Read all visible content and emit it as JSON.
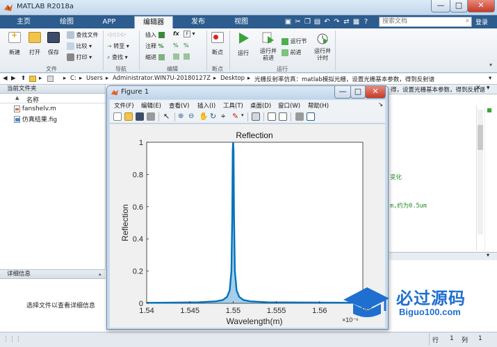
{
  "window": {
    "title": "MATLAB R2018a",
    "min_glyph": "—",
    "max_glyph": "□",
    "close_glyph": "✕"
  },
  "tabs": [
    "主页",
    "绘图",
    "APP",
    "编辑器",
    "发布",
    "视图"
  ],
  "active_tab": "编辑器",
  "search": {
    "placeholder": "搜索文档"
  },
  "login_label": "登录",
  "ribbon": {
    "file": {
      "new": "新建",
      "open": "打开",
      "save": "保存",
      "find_files": "查找文件",
      "compare": "比较",
      "print": "打印",
      "group": "文件"
    },
    "navigate": {
      "goto": "转至",
      "find": "查找",
      "group": "导航"
    },
    "edit": {
      "insert": "插入",
      "comment": "注释",
      "indent": "缩进",
      "fx": "fx",
      "group": "编辑"
    },
    "breakpoints": {
      "label": "断点",
      "group": "断点"
    },
    "run": {
      "run": "运行",
      "run_advance_1": "运行并",
      "run_advance_2": "前进",
      "run_section": "运行节",
      "advance": "前进",
      "run_time_1": "运行并",
      "run_time_2": "计时",
      "group": "运行"
    }
  },
  "address": {
    "drive": "C:",
    "parts": [
      "Users",
      "Administrator.WIN7U-20180127Z",
      "Desktop",
      "光栅反射率仿真：matlab模拟光栅，设置光栅基本参数，得到反射谱"
    ]
  },
  "folder_panel": {
    "title": "当前文件夹",
    "column": "名称",
    "sort": "▲",
    "files": [
      {
        "name": "fanshelv.m",
        "icon": "m-file-icon"
      },
      {
        "name": "仿真结果.fig",
        "icon": "fig-file-icon"
      }
    ]
  },
  "details_panel": {
    "title": "详细信息",
    "message": "选择文件以查看详细信息"
  },
  "editor_peek": {
    "path_tail": "得，设置光栅基本参数，得到反射谱",
    "line1": "变化",
    "line2": "m,约为0.5um"
  },
  "statusbar": {
    "row_label": "行",
    "row_value": "1",
    "col_label": "列",
    "col_value": "1"
  },
  "figure": {
    "title": "Figure 1",
    "menu": [
      "文件(F)",
      "编辑(E)",
      "查看(V)",
      "插入(I)",
      "工具(T)",
      "桌面(D)",
      "窗口(W)",
      "帮助(H)"
    ]
  },
  "chart_data": {
    "type": "line",
    "title": "Reflection",
    "xlabel": "Wavelength(m)",
    "ylabel": "Reflection",
    "x_exponent": "×10⁻⁶",
    "xlim": [
      1.54,
      1.565
    ],
    "ylim": [
      0,
      1
    ],
    "xticks": [
      "1.54",
      "1.545",
      "1.55",
      "1.555",
      "1.56",
      "1.565"
    ],
    "yticks": [
      "0",
      "0.2",
      "0.4",
      "0.6",
      "0.8",
      "1"
    ],
    "series": [
      {
        "color": "#0072bd",
        "x": [
          1.54,
          1.546,
          1.548,
          1.5488,
          1.5493,
          1.5496,
          1.5498,
          1.5499,
          1.54995,
          1.55,
          1.55005,
          1.5501,
          1.5502,
          1.5504,
          1.5507,
          1.5512,
          1.552,
          1.554,
          1.565
        ],
        "y": [
          0.003,
          0.006,
          0.012,
          0.02,
          0.04,
          0.08,
          0.2,
          0.55,
          0.95,
          1.0,
          0.95,
          0.55,
          0.2,
          0.08,
          0.04,
          0.02,
          0.012,
          0.006,
          0.003
        ]
      }
    ],
    "grid": false,
    "legend": "none"
  },
  "watermark": {
    "text": "必过源码",
    "subtext": "Biguo100.com"
  },
  "colors": {
    "accent": "#2d5c8e",
    "plot_line": "#0072bd"
  }
}
